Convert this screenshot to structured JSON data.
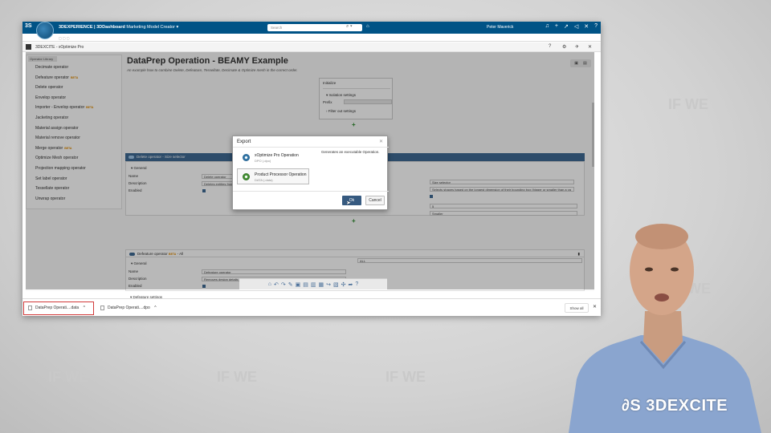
{
  "topbar": {
    "brand_strong": "3DEXPERIENCE | 3DDashboard",
    "brand_rest": "Marketing Model Creator",
    "search_placeholder": "Search",
    "user": "Peter Maverick"
  },
  "window": {
    "title": "3DEXCITE - xOptimize Pro",
    "controls": [
      "?",
      "⚙",
      "✈",
      "✕"
    ]
  },
  "library": {
    "tab": "Operator Library",
    "items": [
      {
        "label": "Decimate operator",
        "beta": ""
      },
      {
        "label": "Defeature operator",
        "beta": "BETA"
      },
      {
        "label": "Delete operator",
        "beta": ""
      },
      {
        "label": "Envelop operator",
        "beta": ""
      },
      {
        "label": "Importer - Envelop operator",
        "beta": "BETA"
      },
      {
        "label": "Jacketing operator",
        "beta": ""
      },
      {
        "label": "Material assign operator",
        "beta": ""
      },
      {
        "label": "Material remove operator",
        "beta": ""
      },
      {
        "label": "Merge operator",
        "beta": "BETA"
      },
      {
        "label": "Optimize Mesh operator",
        "beta": ""
      },
      {
        "label": "Projection mapping operator",
        "beta": ""
      },
      {
        "label": "Set label operator",
        "beta": ""
      },
      {
        "label": "Tessellate operator",
        "beta": ""
      },
      {
        "label": "Unwrap operator",
        "beta": ""
      }
    ]
  },
  "main": {
    "title": "DataPrep Operation - BEAMY Example",
    "subtitle": "An example how to combine Delete, Defeature, Tessellate, Decimate & Optimize mesh in the correct order.",
    "init": {
      "title": "Initialize",
      "isolation": "Isolation settings",
      "prefix_label": "Prefix",
      "filter": "Filter out settings"
    },
    "delete_op": {
      "header": "Delete operator - Size selector",
      "general": "General",
      "name_label": "Name",
      "name_value": "Delete operator",
      "desc_label": "Description",
      "desc_value": "Deletes entities from",
      "enabled_label": "Enabled",
      "selector_value": "Size selector",
      "selector_desc": "Selects shapes based on the longest dimension of their bounding box (bigger or smaller than a va",
      "num_value": "5",
      "mode_value": "Smaller"
    },
    "defeature_op": {
      "header": "Defeature operator",
      "beta": "BETA",
      "header_suffix": "- All",
      "general": "General",
      "name_label": "Name",
      "name_value": "Defeature operator",
      "desc_label": "Description",
      "desc_value": "Removes design details such as holes or fillets from exact geometry",
      "enabled_label": "Enabled",
      "selector_value": "ALL",
      "settings": "Defeature settings"
    }
  },
  "export_dialog": {
    "title": "Export",
    "options": [
      {
        "name": "xOptimize Pro Operation",
        "ext": "DPO (.dpo)",
        "color": "#3a7fb0"
      },
      {
        "name": "Product Processor Operation",
        "ext": "DATA (.data)",
        "color": "#4a9a3a"
      }
    ],
    "description": "Generates an executable Operation.",
    "ok": "Ok",
    "cancel": "Cancel"
  },
  "downloads": {
    "items": [
      "DataPrep Operati....data",
      "DataPrep Operati....dpo"
    ],
    "show_all": "Show all"
  },
  "watermark": "IF WE",
  "brand": "3DEXCITE"
}
